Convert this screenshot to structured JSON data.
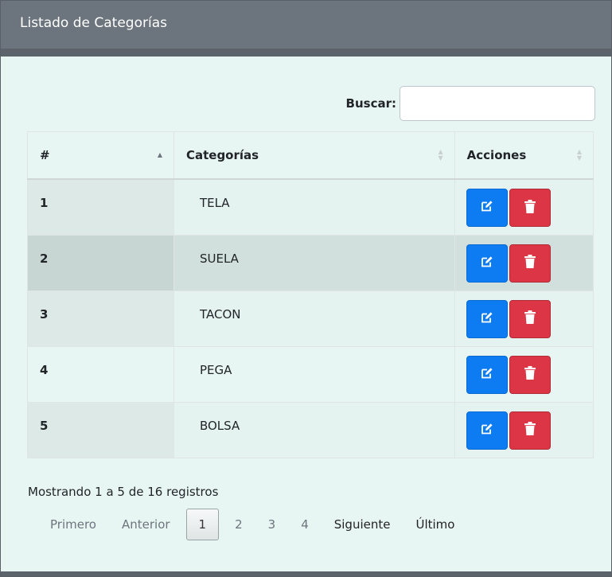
{
  "header": {
    "title": "Listado de Categorías"
  },
  "search": {
    "label": "Buscar:",
    "value": ""
  },
  "table": {
    "columns": [
      "#",
      "Categorías",
      "Acciones"
    ],
    "rows": [
      {
        "id": "1",
        "name": "TELA"
      },
      {
        "id": "2",
        "name": "SUELA"
      },
      {
        "id": "3",
        "name": "TACON"
      },
      {
        "id": "4",
        "name": "PEGA"
      },
      {
        "id": "5",
        "name": "BOLSA"
      }
    ]
  },
  "info": "Mostrando 1 a 5 de 16 registros",
  "pagination": {
    "first": "Primero",
    "previous": "Anterior",
    "pages": [
      "1",
      "2",
      "3",
      "4"
    ],
    "current": "1",
    "next": "Siguiente",
    "last": "Último"
  },
  "colors": {
    "edit": "#0d7cf2",
    "delete": "#dc3545",
    "header": "#6c757d"
  },
  "icons": {
    "edit": "edit-icon",
    "delete": "trash-icon",
    "sort": "sort-icon"
  }
}
